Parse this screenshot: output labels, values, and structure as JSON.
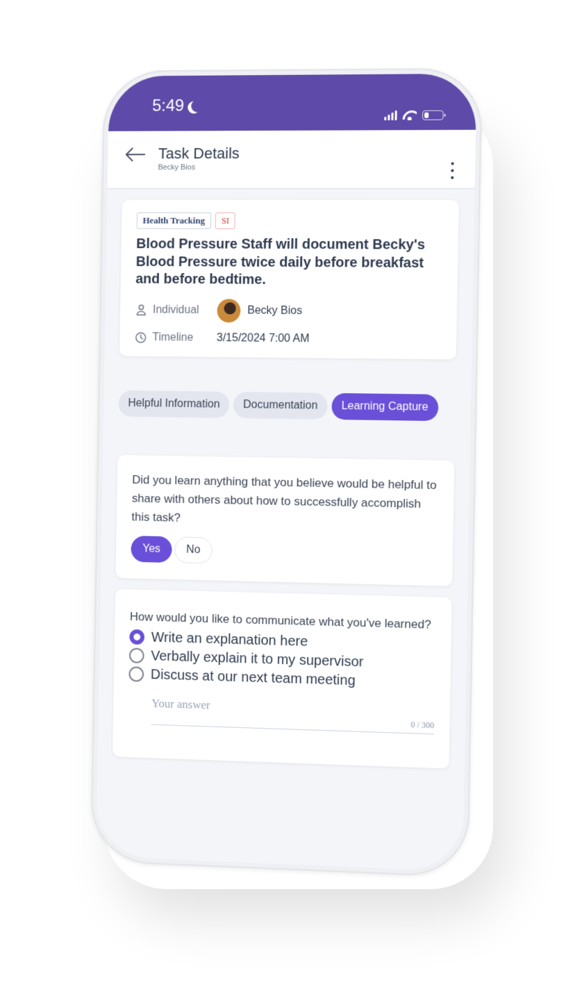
{
  "status_bar": {
    "time": "5:49",
    "battery_level": 0.25,
    "signal_bars": 4
  },
  "header": {
    "title": "Task Details",
    "subtitle": "Becky Bios"
  },
  "task": {
    "tags": [
      "Health Tracking",
      "SI"
    ],
    "title": "Blood Pressure Staff will document Becky's Blood Pressure twice daily before breakfast and before bedtime.",
    "individual_label": "Individual",
    "individual_value": "Becky Bios",
    "timeline_label": "Timeline",
    "timeline_value": "3/15/2024 7:00 AM"
  },
  "tabs": [
    {
      "label": "Helpful Information",
      "active": false
    },
    {
      "label": "Documentation",
      "active": false
    },
    {
      "label": "Learning Capture",
      "active": true
    }
  ],
  "question1": {
    "text": "Did you learn anything that you believe would be helpful to share with others about how to successfully accomplish this task?",
    "options": [
      {
        "label": "Yes",
        "selected": true
      },
      {
        "label": "No",
        "selected": false
      }
    ]
  },
  "question2": {
    "text": "How would you like to communicate what you've learned?",
    "options": [
      {
        "label": "Write an explanation here",
        "selected": true
      },
      {
        "label": "Verbally explain it to my supervisor",
        "selected": false
      },
      {
        "label": "Discuss at our next team meeting",
        "selected": false
      }
    ],
    "answer_value": "",
    "answer_placeholder": "Your answer",
    "counter": "0 / 300"
  },
  "colors": {
    "brand_purple": "#5e4aa8",
    "accent": "#6a4fd8",
    "text_dark": "#2f3a4f",
    "si_red": "#d33d36"
  }
}
